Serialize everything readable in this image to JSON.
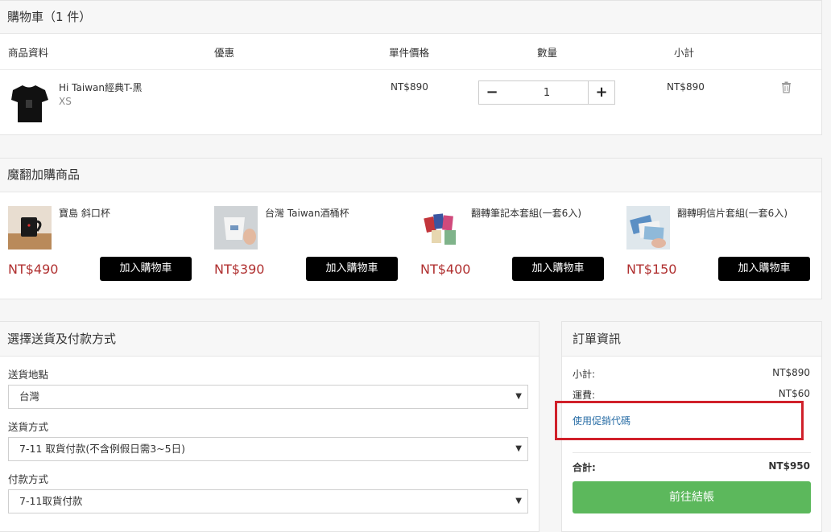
{
  "cart": {
    "title": "購物車（1 件）",
    "headers": {
      "product": "商品資料",
      "discount": "優惠",
      "unit_price": "單件價格",
      "quantity": "數量",
      "subtotal": "小計"
    },
    "item": {
      "name": "Hi Taiwan經典T-黑",
      "variant": "XS",
      "unit_price": "NT$890",
      "quantity": "1",
      "subtotal": "NT$890",
      "minus": "−",
      "plus": "+"
    }
  },
  "addons": {
    "title": "魔翻加購商品",
    "button_label": "加入購物車",
    "items": [
      {
        "name": "寶島 斜口杯",
        "price": "NT$490"
      },
      {
        "name": "台灣 Taiwan酒桶杯",
        "price": "NT$390"
      },
      {
        "name": "翻轉筆記本套組(一套6入)",
        "price": "NT$400"
      },
      {
        "name": "翻轉明信片套組(一套6入)",
        "price": "NT$150"
      }
    ]
  },
  "shipping": {
    "title": "選擇送貨及付款方式",
    "destination_label": "送貨地點",
    "destination_value": "台灣",
    "method_label": "送貨方式",
    "method_value": "7-11 取貨付款(不含例假日需3~5日)",
    "payment_label": "付款方式",
    "payment_value": "7-11取貨付款",
    "caret": "▼"
  },
  "order": {
    "title": "訂單資訊",
    "subtotal_label": "小計:",
    "subtotal_value": "NT$890",
    "shipping_label": "運費:",
    "shipping_value": "NT$60",
    "promo_link": "使用促銷代碼",
    "total_label": "合計:",
    "total_value": "NT$950",
    "checkout_label": "前往結帳"
  },
  "colors": {
    "price_red": "#b03030",
    "checkout_green": "#5cb85c",
    "link_blue": "#2a6ea6",
    "highlight_red": "#d0202a"
  }
}
